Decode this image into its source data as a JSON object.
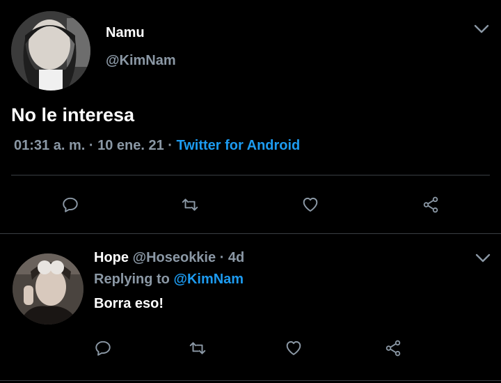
{
  "main_tweet": {
    "display_name": "Namu",
    "handle": "@KimNam",
    "text": "No le interesa",
    "time": "01:31 a. m.",
    "date": "10 ene. 21",
    "sep1": "·",
    "sep2": "·",
    "source": "Twitter for Android"
  },
  "reply_tweet": {
    "display_name": "Hope",
    "handle": "@Hoseokkie",
    "age": "· 4d",
    "replying_label": "Replying to",
    "replying_to": "@KimNam",
    "text": "Borra eso!"
  },
  "icons": {
    "reply": "reply-icon",
    "retweet": "retweet-icon",
    "like": "heart-icon",
    "share": "share-icon",
    "more": "chevron-down-icon"
  },
  "colors": {
    "background": "#000000",
    "text": "#ffffff",
    "muted": "#8b98a5",
    "link": "#1d9bf0",
    "divider": "#3a3f44"
  }
}
